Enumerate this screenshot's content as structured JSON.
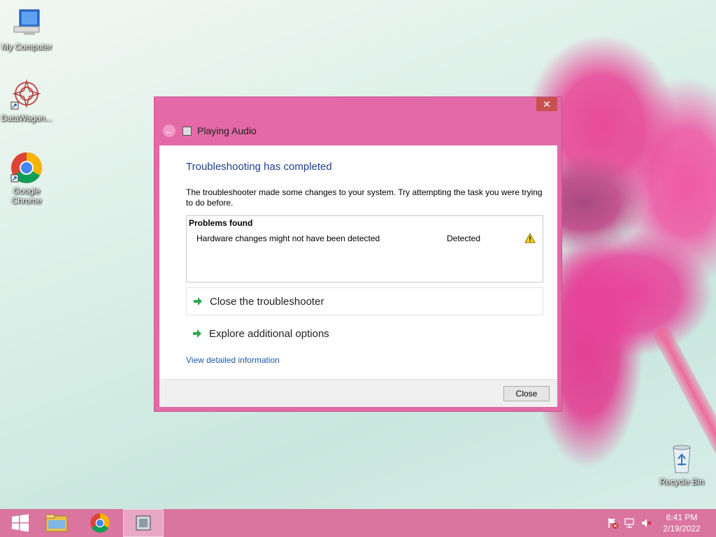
{
  "desktop": {
    "icons": [
      {
        "label": "My Computer",
        "icon": "computer-icon"
      },
      {
        "label": "DataWagon...",
        "icon": "datawagon-icon"
      },
      {
        "label": "Google Chrome",
        "icon": "chrome-icon"
      },
      {
        "label": "Recycle Bin",
        "icon": "recycle-bin-icon"
      }
    ]
  },
  "window": {
    "close_glyph": "✕",
    "back_glyph": "←",
    "title": "Playing Audio",
    "heading": "Troubleshooting has completed",
    "description": "The troubleshooter made some changes to your system. Try attempting the task you were trying to do before.",
    "problems": {
      "header": "Problems found",
      "items": [
        {
          "description": "Hardware changes might not have been detected",
          "status": "Detected",
          "icon": "warning-icon"
        }
      ]
    },
    "options": [
      {
        "label": "Close the troubleshooter",
        "icon": "green-arrow-icon"
      },
      {
        "label": "Explore additional options",
        "icon": "green-arrow-icon"
      }
    ],
    "detail_link": "View detailed information",
    "close_button": "Close",
    "accent_color": "#e36aa7"
  },
  "taskbar": {
    "items": [
      "start-button",
      "file-explorer",
      "google-chrome",
      "troubleshooter"
    ],
    "time": "6:41 PM",
    "date": "2/19/2022",
    "tray_icons": [
      "action-center-flag-icon",
      "network-icon",
      "volume-muted-icon"
    ]
  }
}
